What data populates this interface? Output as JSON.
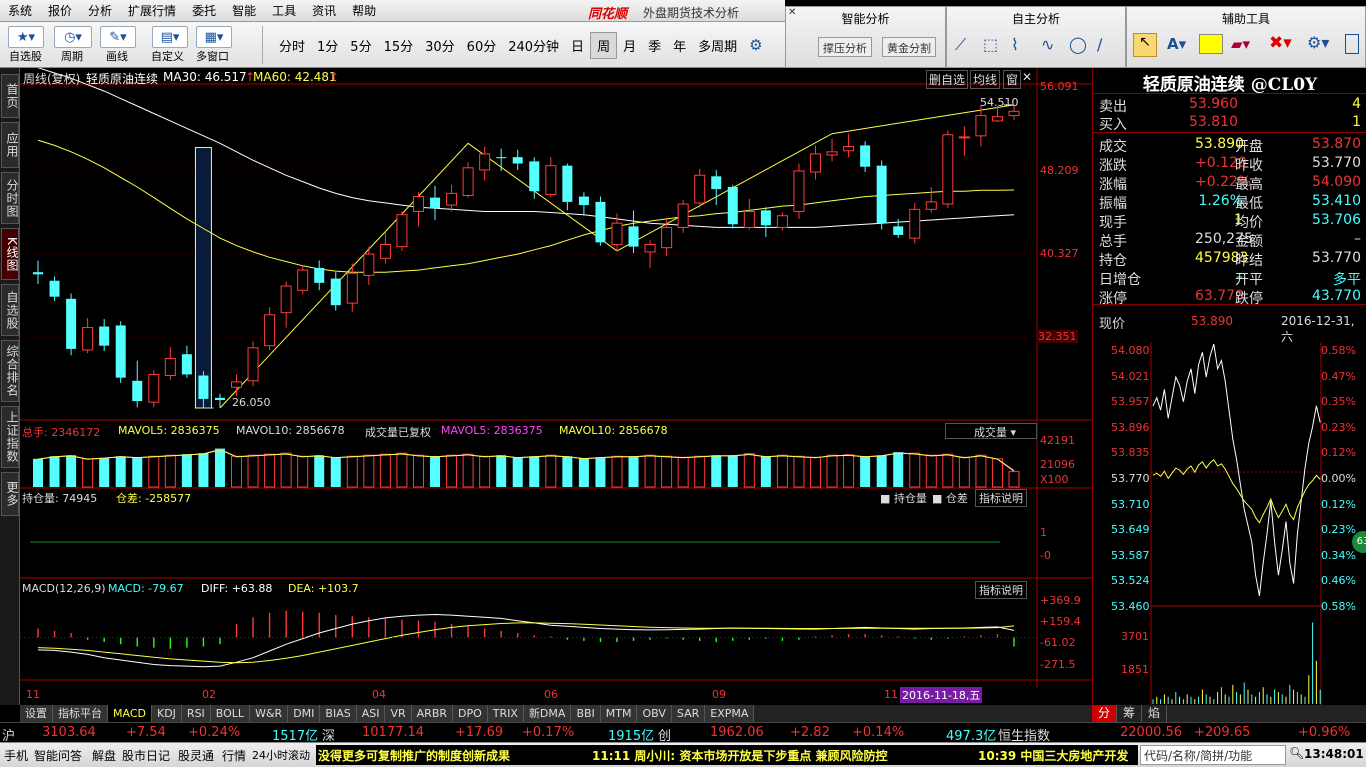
{
  "menu": [
    "系统",
    "报价",
    "分析",
    "扩展行情",
    "委托",
    "智能",
    "工具",
    "资讯",
    "帮助"
  ],
  "logo": "同花顺",
  "app_title": "外盘期货技术分析",
  "toolbar": {
    "buttons": [
      "自选股",
      "周期",
      "画线",
      "自定义",
      "多窗口"
    ],
    "periods": [
      "分时",
      "1分",
      "5分",
      "15分",
      "30分",
      "60分",
      "240分钟",
      "日",
      "周",
      "月",
      "季",
      "年",
      "多周期"
    ],
    "selected_period": "周"
  },
  "panels": {
    "smart": {
      "title": "智能分析",
      "btn1": "撑压分析",
      "btn2": "黄金分割"
    },
    "self": {
      "title": "自主分析"
    },
    "aux": {
      "title": "辅助工具"
    }
  },
  "vtabs": [
    "首页",
    "应用",
    "分时图",
    "K线图",
    "自选股",
    "综合排名",
    "上证指数",
    "更多"
  ],
  "vtab_selected": "K线图",
  "chart_header": {
    "left": "周线(复权)",
    "name": "轻质原油连续",
    "ma30": "MA30: 46.517",
    "ma60": "MA60: 42.481",
    "btns": [
      "删自选",
      "均线",
      "窗"
    ]
  },
  "price_axis": [
    "56.091",
    "48.209",
    "40.327",
    "32.351"
  ],
  "high_label": "54.510",
  "low_label": "26.050",
  "volume_header": {
    "total": "总手: 2346172",
    "mavol5": "MAVOL5: 2836375",
    "mavol10": "MAVOL10: 2856678",
    "mid": "成交量已复权",
    "mavol5b": "MAVOL5: 2836375",
    "mavol10b": "MAVOL10: 2856678",
    "dropdown": "成交量"
  },
  "vol_axis": [
    "42191",
    "21096",
    "X100"
  ],
  "oi_header": {
    "oi": "持仓量: 74945",
    "diff": "仓差: -258577",
    "cb1": "持仓量",
    "cb2": "仓差",
    "btn": "指标说明"
  },
  "oi_axis": [
    "1",
    "0",
    "-0"
  ],
  "macd_header": {
    "name": "MACD(12,26,9)",
    "macd": "MACD: -79.67",
    "diff": "DIFF: +63.88",
    "dea": "DEA: +103.7",
    "btn": "指标说明"
  },
  "macd_axis": [
    "+369.9",
    "+159.4",
    "-61.02",
    "-271.5"
  ],
  "x_axis": [
    "11",
    "02",
    "04",
    "06",
    "09",
    "11"
  ],
  "cursor_date": "2016-11-18,五",
  "chart_data": {
    "type": "candlestick",
    "title": "轻质原油连续",
    "period": "周线(复权)",
    "ylim": [
      26.05,
      56.091
    ],
    "candles": [
      [
        38.8,
        38.6,
        39.9,
        37.7
      ],
      [
        38.0,
        36.5,
        38.4,
        36.1
      ],
      [
        36.3,
        31.6,
        36.8,
        31.0
      ],
      [
        31.5,
        33.6,
        34.5,
        31.2
      ],
      [
        33.7,
        31.9,
        34.4,
        31.4
      ],
      [
        33.8,
        28.9,
        34.2,
        28.4
      ],
      [
        28.6,
        26.7,
        30.5,
        26.1
      ],
      [
        26.6,
        29.2,
        29.6,
        26.1
      ],
      [
        29.1,
        30.7,
        31.8,
        28.7
      ],
      [
        31.1,
        29.2,
        31.9,
        28.9
      ],
      [
        29.1,
        26.9,
        29.5,
        26.05
      ],
      [
        27.0,
        26.8,
        27.4,
        26.1
      ],
      [
        28.0,
        28.5,
        29.2,
        27.2
      ],
      [
        28.6,
        31.7,
        32.3,
        28.1
      ],
      [
        31.9,
        34.8,
        35.5,
        31.5
      ],
      [
        35.0,
        37.5,
        37.9,
        33.6
      ],
      [
        37.1,
        39.0,
        39.4,
        36.7
      ],
      [
        39.2,
        37.8,
        39.9,
        37.1
      ],
      [
        38.2,
        35.7,
        38.8,
        35.2
      ],
      [
        35.9,
        38.7,
        39.6,
        35.1
      ],
      [
        38.5,
        40.5,
        41.2,
        37.6
      ],
      [
        40.1,
        41.4,
        42.6,
        39.6
      ],
      [
        41.2,
        44.2,
        44.5,
        40.8
      ],
      [
        44.5,
        45.9,
        46.3,
        43.1
      ],
      [
        45.8,
        44.8,
        46.9,
        43.7
      ],
      [
        45.1,
        46.2,
        47.0,
        44.5
      ],
      [
        46.0,
        48.6,
        49.1,
        45.8
      ],
      [
        48.4,
        49.9,
        50.6,
        47.4
      ],
      [
        49.6,
        49.5,
        50.4,
        48.3
      ],
      [
        49.6,
        49.0,
        50.3,
        48.4
      ],
      [
        49.2,
        46.4,
        49.6,
        45.7
      ],
      [
        46.1,
        48.8,
        49.6,
        45.8
      ],
      [
        48.8,
        45.4,
        49.0,
        44.6
      ],
      [
        45.9,
        45.1,
        46.3,
        44.1
      ],
      [
        45.4,
        41.6,
        45.9,
        41.3
      ],
      [
        41.4,
        43.4,
        44.3,
        40.8
      ],
      [
        43.1,
        41.2,
        44.6,
        40.6
      ],
      [
        40.7,
        41.4,
        41.8,
        39.2
      ],
      [
        41.1,
        43.0,
        43.8,
        40.3
      ],
      [
        43.0,
        45.2,
        45.6,
        42.5
      ],
      [
        45.3,
        47.9,
        48.5,
        44.8
      ],
      [
        47.8,
        46.6,
        48.4,
        45.1
      ],
      [
        46.8,
        43.3,
        47.0,
        42.9
      ],
      [
        43.0,
        44.5,
        45.7,
        42.8
      ],
      [
        44.6,
        43.2,
        44.9,
        42.1
      ],
      [
        43.0,
        44.1,
        44.4,
        42.7
      ],
      [
        44.5,
        48.3,
        49.0,
        43.8
      ],
      [
        48.2,
        49.9,
        50.7,
        47.5
      ],
      [
        49.8,
        50.1,
        51.3,
        49.2
      ],
      [
        50.2,
        50.6,
        51.8,
        49.6
      ],
      [
        50.7,
        48.7,
        51.1,
        48.2
      ],
      [
        48.8,
        43.4,
        49.3,
        42.8
      ],
      [
        43.1,
        42.3,
        43.8,
        42.0
      ],
      [
        42.0,
        44.7,
        45.3,
        41.5
      ],
      [
        44.7,
        45.4,
        46.8,
        44.4
      ],
      [
        45.2,
        51.7,
        52.1,
        44.8
      ],
      [
        51.5,
        51.5,
        52.5,
        49.7
      ],
      [
        51.6,
        53.5,
        54.5,
        50.6
      ],
      [
        53.0,
        53.4,
        54.4,
        52.9
      ],
      [
        53.5,
        53.9,
        54.51,
        53.1
      ]
    ],
    "ma30": [
      58.0,
      57.5,
      57.0,
      56.4,
      55.8,
      55.1,
      54.4,
      53.7,
      53.0,
      52.3,
      51.6,
      50.9,
      50.1,
      49.3,
      48.6,
      47.9,
      47.3,
      46.7,
      46.2,
      45.8,
      45.5,
      45.3,
      45.1,
      44.9,
      44.8,
      44.7,
      44.6,
      44.5,
      44.5,
      44.5,
      44.5,
      44.4,
      44.3,
      44.2,
      44.0,
      43.8,
      43.6,
      43.4,
      43.3,
      43.2,
      43.1,
      43.0,
      43.0,
      43.0,
      43.0,
      43.0,
      43.0,
      43.0,
      43.1,
      43.2,
      43.3,
      43.4,
      43.5,
      43.6,
      43.7,
      43.8,
      43.9,
      44.0,
      44.1,
      44.2
    ],
    "ma60": [
      51.2,
      50.7,
      50.1,
      49.4,
      48.6,
      47.7,
      46.8,
      45.8,
      44.8,
      43.8,
      42.9,
      42.0,
      41.3,
      40.7,
      40.2,
      39.8,
      39.4,
      39.1,
      38.9,
      38.8,
      38.8,
      38.8,
      38.9,
      39.0,
      39.2,
      39.4,
      39.6,
      39.9,
      40.2,
      40.5,
      40.9,
      41.3,
      41.8,
      42.3,
      42.7,
      43.1,
      43.4,
      43.6,
      43.8,
      44.0,
      44.1,
      44.3,
      44.4,
      44.6,
      44.8,
      45.0,
      45.1,
      45.3,
      45.5,
      45.7,
      45.9,
      46.0,
      46.1,
      46.2,
      46.3,
      46.4,
      46.4,
      46.5,
      46.5,
      46.517
    ],
    "volume_ratio": [
      0.55,
      0.6,
      0.62,
      0.55,
      0.57,
      0.6,
      0.58,
      0.6,
      0.62,
      0.64,
      0.66,
      0.75,
      0.6,
      0.62,
      0.64,
      0.66,
      0.6,
      0.62,
      0.58,
      0.6,
      0.62,
      0.64,
      0.66,
      0.62,
      0.6,
      0.62,
      0.64,
      0.6,
      0.62,
      0.58,
      0.6,
      0.62,
      0.6,
      0.56,
      0.58,
      0.6,
      0.6,
      0.62,
      0.6,
      0.58,
      0.6,
      0.62,
      0.62,
      0.65,
      0.6,
      0.62,
      0.6,
      0.58,
      0.62,
      0.63,
      0.6,
      0.62,
      0.68,
      0.66,
      0.62,
      0.64,
      0.58,
      0.62,
      0.55,
      0.3
    ],
    "macd_bar": [
      80,
      60,
      40,
      -20,
      -40,
      -60,
      -80,
      -90,
      -100,
      -90,
      -80,
      -60,
      120,
      180,
      220,
      240,
      230,
      220,
      200,
      190,
      180,
      170,
      160,
      150,
      140,
      120,
      100,
      80,
      60,
      40,
      20,
      10,
      -20,
      -30,
      -40,
      -40,
      -30,
      -20,
      -10,
      -20,
      -30,
      -40,
      -30,
      -20,
      -10,
      -30,
      -20,
      10,
      20,
      30,
      30,
      20,
      10,
      -10,
      -20,
      -10,
      10,
      20,
      30,
      -79.67
    ],
    "diff": [
      -110,
      -115,
      -130,
      -150,
      -180,
      -200,
      -220,
      -240,
      -250,
      -255,
      -260,
      -255,
      -220,
      -180,
      -120,
      -60,
      -10,
      40,
      80,
      120,
      150,
      175,
      190,
      200,
      205,
      200,
      190,
      180,
      170,
      150,
      130,
      110,
      100,
      90,
      80,
      75,
      70,
      68,
      70,
      72,
      75,
      80,
      85,
      82,
      80,
      78,
      76,
      75,
      80,
      85,
      90,
      85,
      80,
      75,
      80,
      82,
      85,
      90,
      95,
      63.88
    ],
    "dea": [
      -90,
      -95,
      -105,
      -115,
      -130,
      -145,
      -160,
      -175,
      -190,
      -200,
      -210,
      -220,
      -225,
      -220,
      -205,
      -185,
      -160,
      -130,
      -100,
      -70,
      -40,
      -10,
      20,
      45,
      70,
      90,
      105,
      115,
      125,
      130,
      130,
      128,
      124,
      118,
      112,
      105,
      98,
      92,
      88,
      85,
      83,
      82,
      82,
      82,
      82,
      81,
      80,
      80,
      80,
      81,
      82,
      83,
      83,
      82,
      82,
      82,
      83,
      85,
      88,
      103.7
    ]
  },
  "quote": {
    "title": "轻质原油连续 @CL0Y",
    "sell": {
      "label": "卖出",
      "price": "53.960",
      "vol": "4"
    },
    "buy": {
      "label": "买入",
      "price": "53.810",
      "vol": "1"
    },
    "rows": [
      {
        "l": "成交",
        "v": "53.890",
        "l2": "开盘",
        "v2": "53.870"
      },
      {
        "l": "涨跌",
        "v": "+0.120",
        "l2": "昨收",
        "v2": "53.770"
      },
      {
        "l": "涨幅",
        "v": "+0.22%",
        "l2": "最高",
        "v2": "54.090"
      },
      {
        "l": "振幅",
        "v": "1.26%",
        "l2": "最低",
        "v2": "53.410"
      },
      {
        "l": "现手",
        "v": "1",
        "l2": "均价",
        "v2": "53.706"
      },
      {
        "l": "总手",
        "v": "250,275",
        "l2": "金额",
        "v2": "–"
      },
      {
        "l": "持仓",
        "v": "457983",
        "l2": "昨结",
        "v2": "53.770"
      },
      {
        "l": "日增仓",
        "v": "–",
        "l2": "开平",
        "v2": "多平"
      },
      {
        "l": "涨停",
        "v": "63.770",
        "l2": "跌停",
        "v2": "43.770"
      }
    ],
    "now_label": "现价",
    "now_price": "53.890",
    "now_date": "2016-12-31,六",
    "mini_left": [
      "54.080",
      "54.021",
      "53.957",
      "53.896",
      "53.835",
      "53.770",
      "53.710",
      "53.649",
      "53.587",
      "53.524",
      "53.460"
    ],
    "mini_right": [
      "0.58%",
      "0.47%",
      "0.35%",
      "0.23%",
      "0.12%",
      "0.00%",
      "0.12%",
      "0.23%",
      "0.34%",
      "0.46%",
      "0.58%"
    ],
    "mini_vol": [
      "3701",
      "1851"
    ],
    "badge": "63",
    "tabs": [
      "分",
      "筹",
      "焰"
    ]
  },
  "bottom_tabs": [
    "设置",
    "指标平台",
    "MACD",
    "KDJ",
    "RSI",
    "BOLL",
    "W&R",
    "DMI",
    "BIAS",
    "ASI",
    "VR",
    "ARBR",
    "DPO",
    "TRIX",
    "新DMA",
    "BBI",
    "MTM",
    "OBV",
    "SAR",
    "EXPMA"
  ],
  "bottom_selected": "MACD",
  "ticker": {
    "sh": "沪",
    "sh_val": "3103.64",
    "sh_chg": "+7.54",
    "sh_pct": "+0.24%",
    "sh_amt": "1517亿",
    "sz": "深",
    "sz_val": "10177.14",
    "sz_chg": "+17.69",
    "sz_pct": "+0.17%",
    "sz_amt": "1915亿",
    "cy": "创",
    "cy_val": "1962.06",
    "cy_chg": "+2.82",
    "cy_pct": "+0.14%",
    "cy_amt": "497.3亿",
    "hs": "恒生指数",
    "hs_val": "22000.56",
    "hs_chg": "+209.65",
    "hs_pct": "+0.96%"
  },
  "status": {
    "items": [
      "手机",
      "智能问答",
      "解盘",
      "股市日记",
      "股灵通",
      "行情",
      "24小时滚动"
    ],
    "news1": "没得更多可复制推广的制度创新成果",
    "news2": "11:11 周小川: 资本市场开放是下步重点 兼顾风险防控",
    "news3": "10:39 中国三大房地产开发",
    "search": "代码/名称/简拼/功能",
    "time": "13:48:01"
  },
  "colors": {
    "up": "#ff3b3b",
    "down": "#54ffff",
    "ma30": "#ffffff",
    "ma60": "#ffff44",
    "axis": "#ff2a2a"
  }
}
